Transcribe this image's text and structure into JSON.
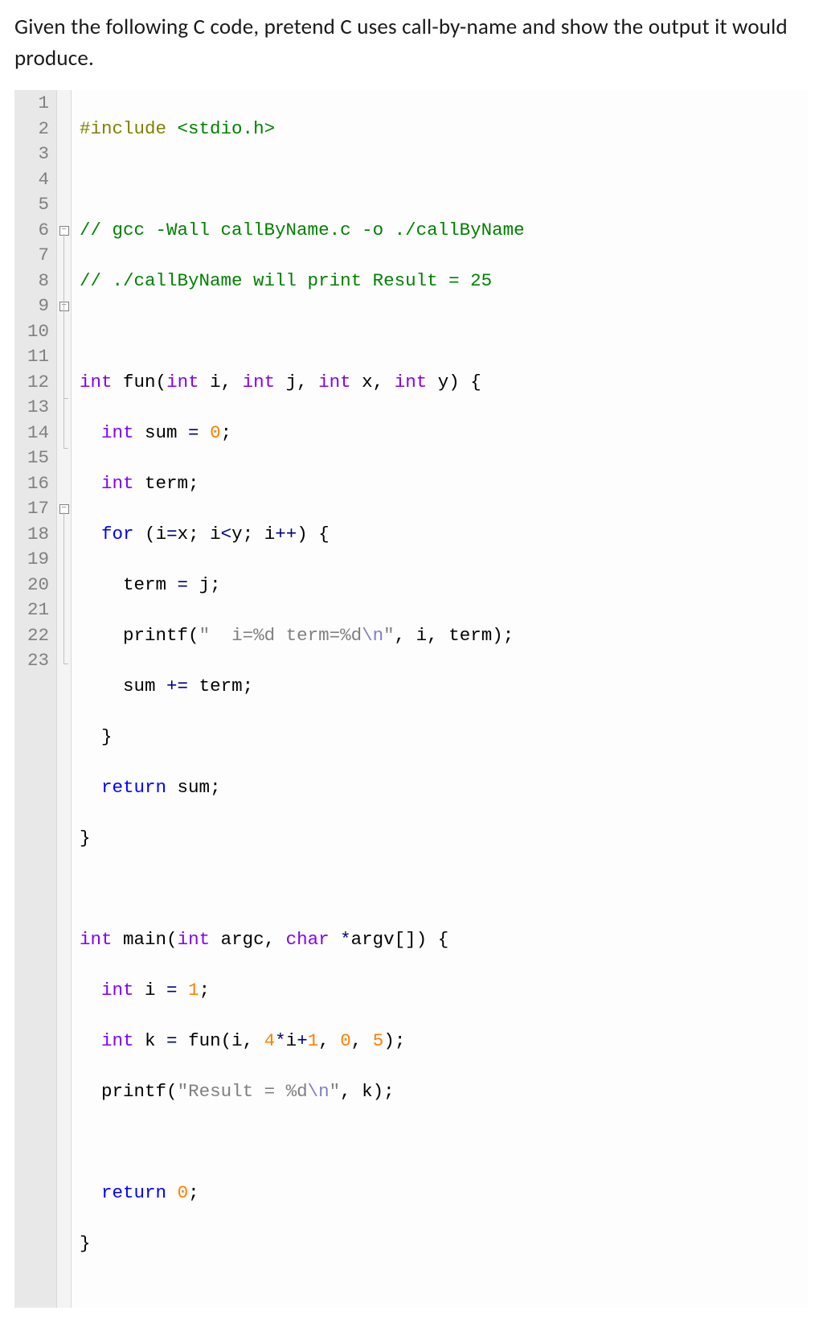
{
  "question": "Given the following C code, pretend C uses call-by-name and show the output it would produce.",
  "gutter": [
    "1",
    "2",
    "3",
    "4",
    "5",
    "6",
    "7",
    "8",
    "9",
    "10",
    "11",
    "12",
    "13",
    "14",
    "15",
    "16",
    "17",
    "18",
    "19",
    "20",
    "21",
    "22",
    "23"
  ],
  "code": {
    "l1a": "#include",
    "l1b": " <stdio.h>",
    "l3": "// gcc -Wall callByName.c -o ./callByName",
    "l4": "// ./callByName will print Result = 25",
    "l6_int1": "int",
    "l6_fun": " fun",
    "l6_p1": "(",
    "l6_int2": "int",
    "l6_i": " i",
    "l6_c1": ", ",
    "l6_int3": "int",
    "l6_j": " j",
    "l6_c2": ", ",
    "l6_int4": "int",
    "l6_x": " x",
    "l6_c3": ", ",
    "l6_int5": "int",
    "l6_y": " y",
    "l6_p2": ")",
    "l6_br": " {",
    "l7_int": "  int",
    "l7_sum": " sum ",
    "l7_eq": "=",
    "l7_sp": " ",
    "l7_zero": "0",
    "l7_sc": ";",
    "l8_int": "  int",
    "l8_term": " term",
    "l8_sc": ";",
    "l9_for": "  for",
    "l9_sp": " ",
    "l9_p1": "(",
    "l9_i1": "i",
    "l9_eq": "=",
    "l9_x": "x",
    "l9_sc1": ";",
    "l9_sp2": " ",
    "l9_i2": "i",
    "l9_lt": "<",
    "l9_y": "y",
    "l9_sc2": ";",
    "l9_sp3": " ",
    "l9_i3": "i",
    "l9_pp": "++",
    "l9_p2": ")",
    "l9_br": " {",
    "l10_term": "    term ",
    "l10_eq": "=",
    "l10_j": " j",
    "l10_sc": ";",
    "l11_pf": "    printf",
    "l11_p1": "(",
    "l11_str": "\"  i=%d term=%d",
    "l11_esc": "\\n",
    "l11_qe": "\"",
    "l11_c1": ",",
    "l11_sp1": " i",
    "l11_c2": ",",
    "l11_sp2": " term",
    "l11_p2": ")",
    "l11_sc": ";",
    "l12_sum": "    sum ",
    "l12_pe": "+=",
    "l12_term": " term",
    "l12_sc": ";",
    "l13_br": "  }",
    "l14_ret": "  return",
    "l14_sum": " sum",
    "l14_sc": ";",
    "l15_br": "}",
    "l17_int": "int",
    "l17_main": " main",
    "l17_p1": "(",
    "l17_int2": "int",
    "l17_argc": " argc",
    "l17_c1": ", ",
    "l17_char": "char",
    "l17_star": " *",
    "l17_argv": "argv",
    "l17_br1": "[",
    "l17_br2": "]",
    "l17_p2": ")",
    "l17_br3": " {",
    "l18_int": "  int",
    "l18_i": " i ",
    "l18_eq": "=",
    "l18_sp": " ",
    "l18_one": "1",
    "l18_sc": ";",
    "l19_int": "  int",
    "l19_k": " k ",
    "l19_eq": "=",
    "l19_fun": " fun",
    "l19_p1": "(",
    "l19_i": "i",
    "l19_c1": ",",
    "l19_sp1": " ",
    "l19_four": "4",
    "l19_star": "*",
    "l19_i2": "i",
    "l19_plus": "+",
    "l19_one": "1",
    "l19_c2": ",",
    "l19_sp2": " ",
    "l19_zero": "0",
    "l19_c3": ",",
    "l19_sp3": " ",
    "l19_five": "5",
    "l19_p2": ")",
    "l19_sc": ";",
    "l20_pf": "  printf",
    "l20_p1": "(",
    "l20_str": "\"Result = %d",
    "l20_esc": "\\n",
    "l20_qe": "\"",
    "l20_c1": ",",
    "l20_k": " k",
    "l20_p2": ")",
    "l20_sc": ";",
    "l22_ret": "  return",
    "l22_sp": " ",
    "l22_zero": "0",
    "l22_sc": ";",
    "l23_br": "}"
  }
}
